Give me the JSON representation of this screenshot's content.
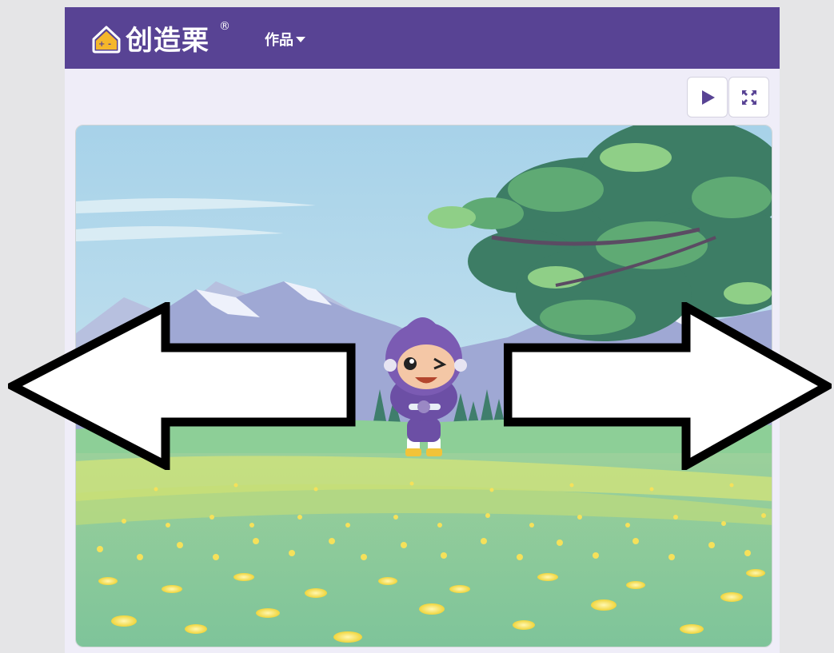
{
  "header": {
    "brand_name": "创造栗",
    "registered_mark": "®",
    "menu_works_label": "作品"
  },
  "toolbar": {
    "play_icon": "play-icon",
    "fullscreen_icon": "fullscreen-icon"
  },
  "stage": {
    "scene": "meadow-scene",
    "left_arrow_icon": "left-arrow-icon",
    "right_arrow_icon": "right-arrow-icon"
  },
  "colors": {
    "topbar": "#584394",
    "panel": "#efedf8",
    "accent_play": "#584394"
  }
}
